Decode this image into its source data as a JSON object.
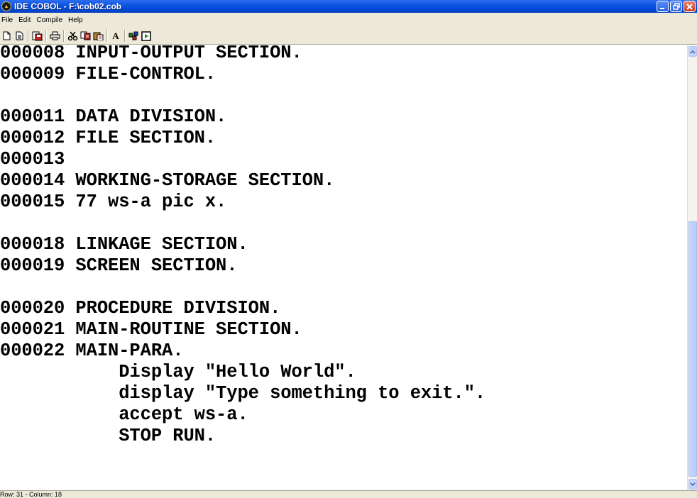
{
  "window": {
    "title": "IDE COBOL - F:\\cob02.cob",
    "icon": "ide-cobol-app-icon",
    "controls": {
      "minimize": "_",
      "maximize": "□",
      "close": "✕"
    }
  },
  "menu": {
    "items": [
      "File",
      "Edit",
      "Compile",
      "Help"
    ]
  },
  "toolbar": {
    "buttons": [
      "new-file",
      "open-file",
      "save-file",
      "print",
      "cut",
      "copy",
      "paste",
      "font",
      "compile",
      "run"
    ],
    "font_label": "A"
  },
  "editor": {
    "lines": [
      "000008 INPUT-OUTPUT SECTION.",
      "000009 FILE-CONTROL.",
      "",
      "000011 DATA DIVISION.",
      "000012 FILE SECTION.",
      "000013",
      "000014 WORKING-STORAGE SECTION.",
      "000015 77 ws-a pic x.",
      "",
      "000018 LINKAGE SECTION.",
      "000019 SCREEN SECTION.",
      "",
      "000020 PROCEDURE DIVISION.",
      "000021 MAIN-ROUTINE SECTION.",
      "000022 MAIN-PARA.",
      "           Display \"Hello World\".",
      "           display \"Type something to exit.\".",
      "           accept ws-a.",
      "           STOP RUN."
    ]
  },
  "scrollbar": {
    "up_arrow": "⌃",
    "down_arrow": "⌄"
  },
  "status": {
    "text": "Row: 31 - Column: 18"
  },
  "colors": {
    "titlebar": "#0a53e0",
    "chrome": "#ece9d8",
    "text": "#000000"
  }
}
